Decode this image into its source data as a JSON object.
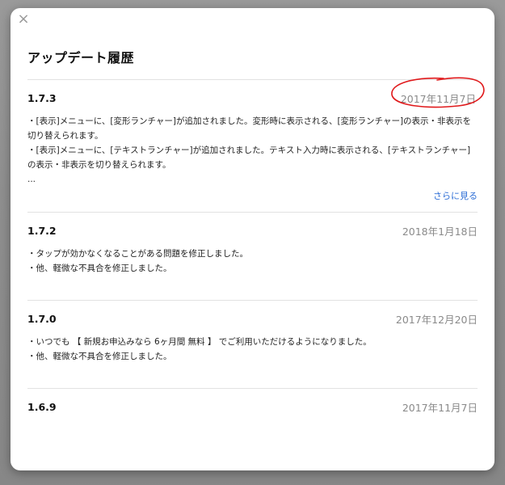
{
  "modal": {
    "title": "アップデート履歴",
    "close_glyph": "×",
    "annotation_color": "#e0191b",
    "link_color": "#2f6fd6"
  },
  "entries": [
    {
      "version": "1.7.3",
      "date": "2017年11月7日",
      "notes": [
        "・[表示]メニューに、[変形ランチャー]が追加されました。変形時に表示される、[変形ランチャー]の表示・非表示を切り替えられます。",
        "・[表示]メニューに、[テキストランチャー]が追加されました。テキスト入力時に表示される、[テキストランチャー]の表示・非表示を切り替えられます。",
        "..."
      ],
      "more_label": "さらに見る"
    },
    {
      "version": "1.7.2",
      "date": "2018年1月18日",
      "notes": [
        "・タップが効かなくなることがある問題を修正しました。",
        "・他、軽微な不具合を修正しました。"
      ]
    },
    {
      "version": "1.7.0",
      "date": "2017年12月20日",
      "notes": [
        "・いつでも 【 新規お申込みなら 6ヶ月間 無料 】 でご利用いただけるようになりました。",
        "・他、軽微な不具合を修正しました。"
      ]
    },
    {
      "version": "1.6.9",
      "date": "2017年11月7日",
      "notes": []
    }
  ]
}
